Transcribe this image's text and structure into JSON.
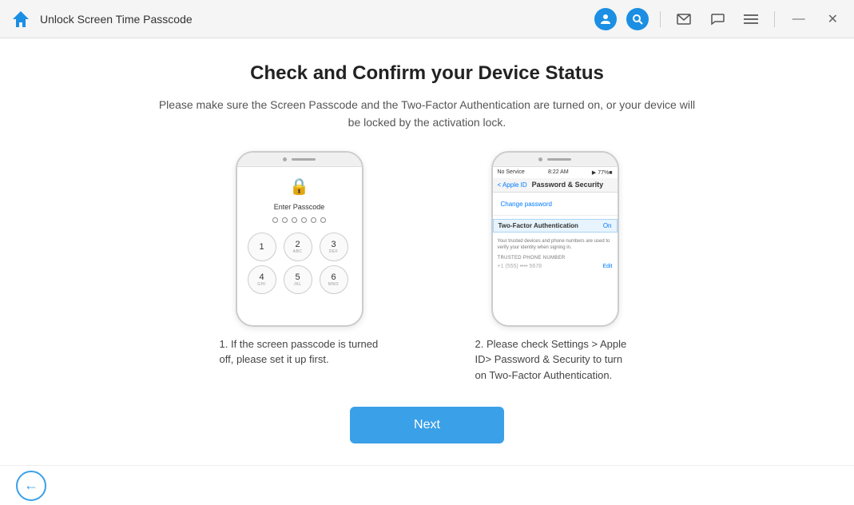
{
  "titleBar": {
    "title": "Unlock Screen Time Passcode",
    "icons": {
      "user": "👤",
      "search": "🔍",
      "mail": "✉",
      "chat": "💬",
      "menu": "☰",
      "minimize": "—",
      "close": "✕"
    }
  },
  "main": {
    "title": "Check and Confirm your Device Status",
    "subtitle": "Please make sure the Screen Passcode and the Two-Factor Authentication are turned on, or your device will be locked by the activation lock.",
    "phone1": {
      "lockIcon": "🔒",
      "enterPasscodeText": "Enter Passcode",
      "keys": [
        {
          "num": "1",
          "sub": ""
        },
        {
          "num": "2",
          "sub": "ABC"
        },
        {
          "num": "3",
          "sub": "DEF"
        },
        {
          "num": "4",
          "sub": "GHI"
        },
        {
          "num": "5",
          "sub": "JKL"
        },
        {
          "num": "6",
          "sub": "MNO"
        }
      ]
    },
    "phone2": {
      "noService": "No Service",
      "time": "8:22 AM",
      "battery": "77%",
      "backLabel": "< Apple ID",
      "navTitle": "Password & Security",
      "changePassword": "Change password",
      "tfaLabel": "Two-Factor Authentication",
      "tfaStatus": "On",
      "description": "Your trusted devices and phone numbers are used to verify your identity when signing in.",
      "trustedHeader": "TRUSTED PHONE NUMBER",
      "editLabel": "Edit"
    },
    "caption1": "1. If the screen passcode is turned off, please set it up first.",
    "caption2": "2. Please check Settings > Apple ID> Password & Security to turn on Two-Factor Authentication.",
    "nextButton": "Next"
  },
  "footer": {
    "backArrow": "←"
  }
}
